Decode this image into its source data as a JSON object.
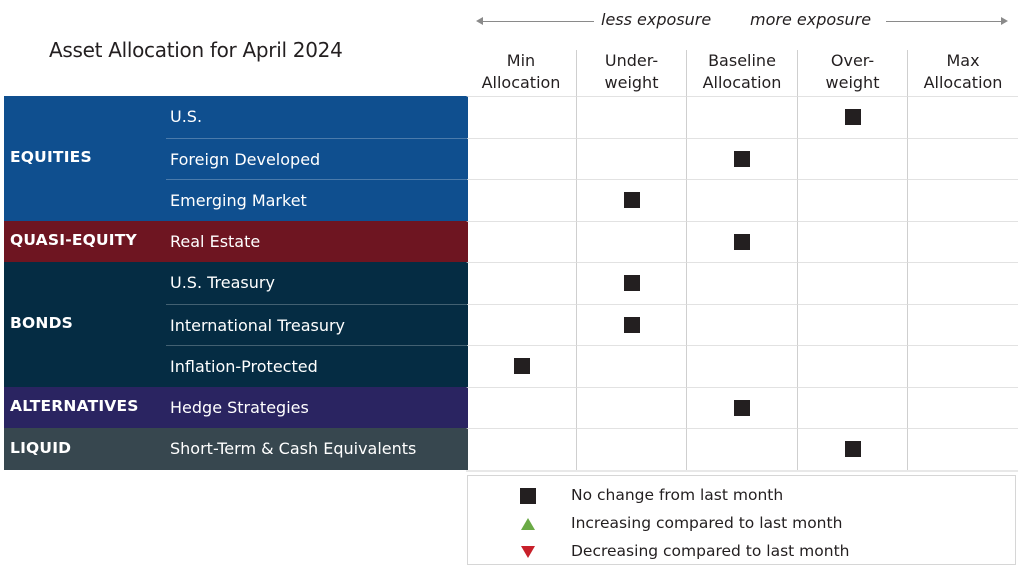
{
  "title": "Asset Allocation for April 2024",
  "exposure": {
    "left_label": "less exposure",
    "right_label": "more exposure"
  },
  "chart_data": {
    "type": "table",
    "title": "Asset Allocation for April 2024",
    "columns": [
      {
        "line1": "Min",
        "line2": "Allocation"
      },
      {
        "line1": "Under-",
        "line2": "weight"
      },
      {
        "line1": "Baseline",
        "line2": "Allocation"
      },
      {
        "line1": "Over-",
        "line2": "weight"
      },
      {
        "line1": "Max",
        "line2": "Allocation"
      }
    ],
    "categories": [
      {
        "name": "EQUITIES",
        "color": "#0f4f8f",
        "rows": [
          {
            "asset": "U.S.",
            "position": 3,
            "position_label": "Over-weight",
            "change": "No change"
          },
          {
            "asset": "Foreign Developed",
            "position": 2,
            "position_label": "Baseline Allocation",
            "change": "No change"
          },
          {
            "asset": "Emerging Market",
            "position": 1,
            "position_label": "Under-weight",
            "change": "No change"
          }
        ]
      },
      {
        "name": "QUASI-EQUITY",
        "color": "#6e1521",
        "rows": [
          {
            "asset": "Real Estate",
            "position": 2,
            "position_label": "Baseline Allocation",
            "change": "No change"
          }
        ]
      },
      {
        "name": "BONDS",
        "color": "#052c43",
        "rows": [
          {
            "asset": "U.S. Treasury",
            "position": 1,
            "position_label": "Under-weight",
            "change": "No change"
          },
          {
            "asset": "International Treasury",
            "position": 1,
            "position_label": "Under-weight",
            "change": "No change"
          },
          {
            "asset": "Inflation-Protected",
            "position": 0,
            "position_label": "Min Allocation",
            "change": "No change"
          }
        ]
      },
      {
        "name": "ALTERNATIVES",
        "color": "#2a2461",
        "rows": [
          {
            "asset": "Hedge Strategies",
            "position": 2,
            "position_label": "Baseline Allocation",
            "change": "No change"
          }
        ]
      },
      {
        "name": "LIQUID",
        "color": "#37474f",
        "rows": [
          {
            "asset": "Short-Term & Cash Equivalents",
            "position": 3,
            "position_label": "Over-weight",
            "change": "No change"
          }
        ]
      }
    ]
  },
  "legend": [
    {
      "symbol": "square",
      "label": "No change from last month",
      "color": "#231f20"
    },
    {
      "symbol": "up",
      "label": "Increasing compared to last month",
      "color": "#6aaa45"
    },
    {
      "symbol": "down",
      "label": "Decreasing compared to last month",
      "color": "#c8202a"
    }
  ]
}
